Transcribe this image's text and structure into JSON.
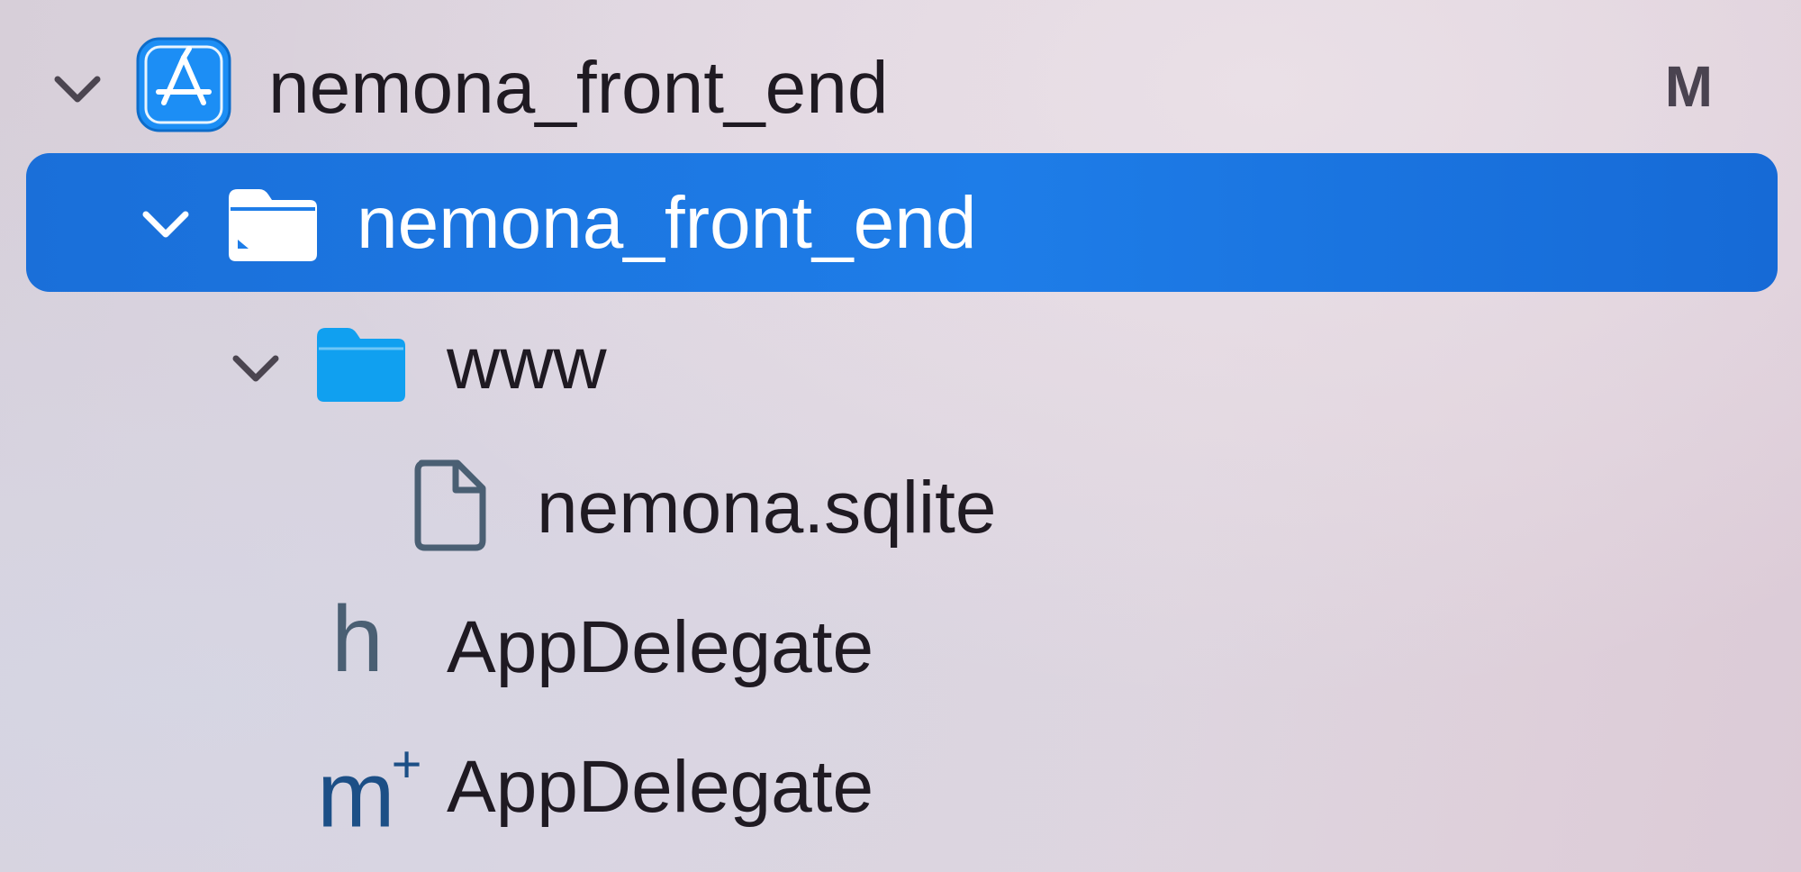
{
  "tree": {
    "project": {
      "label": "nemona_front_end",
      "badge": "M",
      "icon": "xcode-app-icon"
    },
    "group": {
      "label": "nemona_front_end",
      "icon": "folder-icon",
      "selected": true
    },
    "www_folder": {
      "label": "www",
      "icon": "blue-folder-icon"
    },
    "sqlite_file": {
      "label": "nemona.sqlite",
      "icon": "document-icon"
    },
    "header_file": {
      "label": "AppDelegate",
      "glyph": "h",
      "icon": "header-file-icon"
    },
    "objc_file": {
      "label": "AppDelegate",
      "glyph": "m",
      "glyph_sup": "+",
      "icon": "objc-file-icon"
    }
  },
  "colors": {
    "selection": "#1e7de8",
    "folder_blue": "#10a0f0",
    "app_icon": "#1c8ef5"
  }
}
